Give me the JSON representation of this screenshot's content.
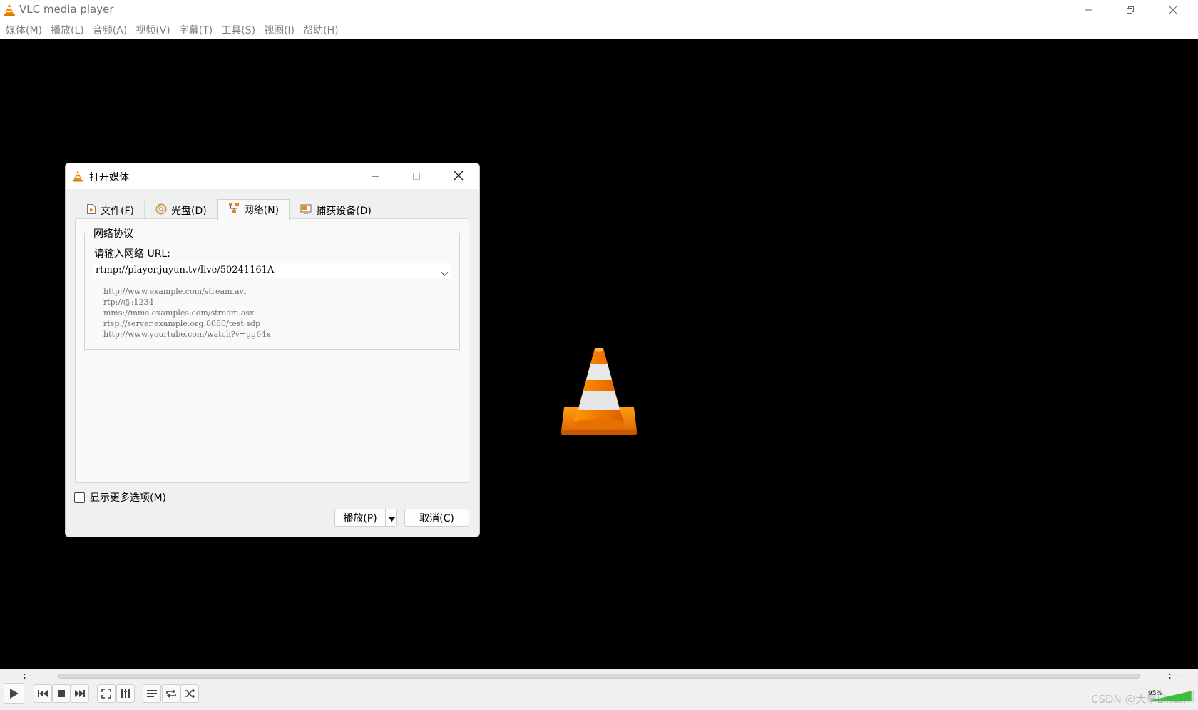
{
  "window": {
    "title": "VLC media player"
  },
  "menu": [
    {
      "label": "媒体(M)"
    },
    {
      "label": "播放(L)"
    },
    {
      "label": "音频(A)"
    },
    {
      "label": "视频(V)"
    },
    {
      "label": "字幕(T)"
    },
    {
      "label": "工具(S)"
    },
    {
      "label": "视图(I)"
    },
    {
      "label": "帮助(H)"
    }
  ],
  "dialog": {
    "title": "打开媒体",
    "tabs": [
      {
        "label": "文件(F)",
        "icon": "file-icon"
      },
      {
        "label": "光盘(D)",
        "icon": "disc-icon"
      },
      {
        "label": "网络(N)",
        "icon": "network-icon",
        "active": true
      },
      {
        "label": "捕获设备(D)",
        "icon": "capture-icon"
      }
    ],
    "group_title": "网络协议",
    "url_label": "请输入网络 URL:",
    "url_value": "rtmp://player.juyun.tv/live/50241161A",
    "examples": [
      "http://www.example.com/stream.avi",
      "rtp://@:1234",
      "mms://mms.examples.com/stream.asx",
      "rtsp://server.example.org:8080/test.sdp",
      "http://www.yourtube.com/watch?v=gg64x"
    ],
    "more_options_label": "显示更多选项(M)",
    "more_options_checked": false,
    "play_label": "播放(P)",
    "cancel_label": "取消(C)"
  },
  "playback": {
    "elapsed": "--:--",
    "remaining": "--:--",
    "volume_label": "95%",
    "volume_level": 0.95
  },
  "watermark": "CSDN @大學Linux",
  "colors": {
    "cone_orange": "#f08a00",
    "volume_green": "#3cbf3c"
  }
}
